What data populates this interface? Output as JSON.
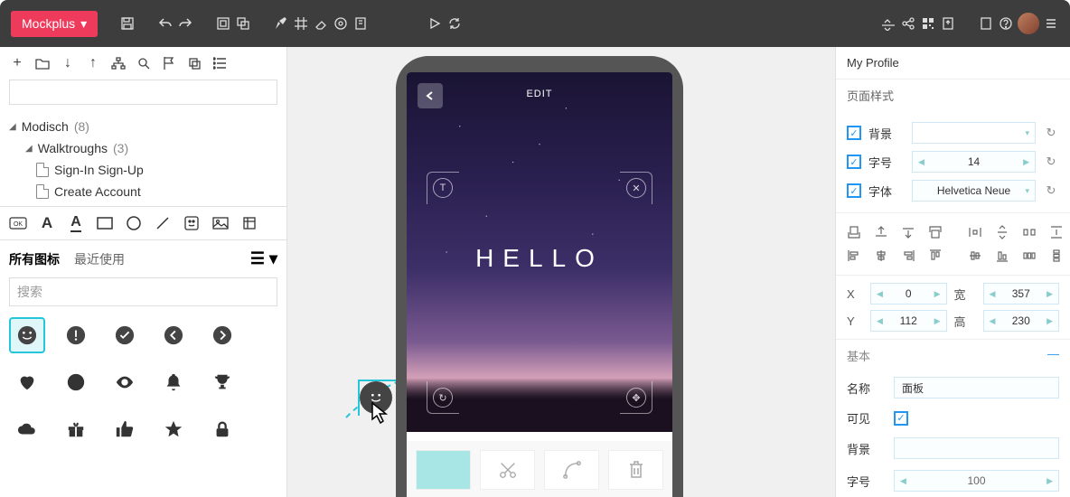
{
  "brand": "Mockplus",
  "tree": {
    "project": "Modisch",
    "project_count": "(8)",
    "folder": "Walktroughs",
    "folder_count": "(3)",
    "pages": [
      "Sign-In Sign-Up",
      "Create Account"
    ]
  },
  "iconPanel": {
    "tab_all": "所有图标",
    "tab_recent": "最近使用",
    "search_placeholder": "搜索"
  },
  "canvas": {
    "edit_label": "EDIT",
    "hello": "HELLO",
    "corner_t": "T",
    "corner_x": "✕",
    "corner_reload": "↻",
    "corner_move": "✥"
  },
  "right": {
    "header": "My Profile",
    "pageStyle": "页面样式",
    "bg": "背景",
    "fontSize": "字号",
    "fontFamily": "字体",
    "fontSizeVal": "14",
    "fontFamilyVal": "Helvetica Neue",
    "x": "X",
    "xVal": "0",
    "y": "Y",
    "yVal": "112",
    "w": "宽",
    "wVal": "357",
    "h": "高",
    "hVal": "230",
    "basic": "基本",
    "name": "名称",
    "nameVal": "面板",
    "visible": "可见",
    "bg2": "背景",
    "fontSize2": "字号",
    "fontSize2Val": "100"
  }
}
